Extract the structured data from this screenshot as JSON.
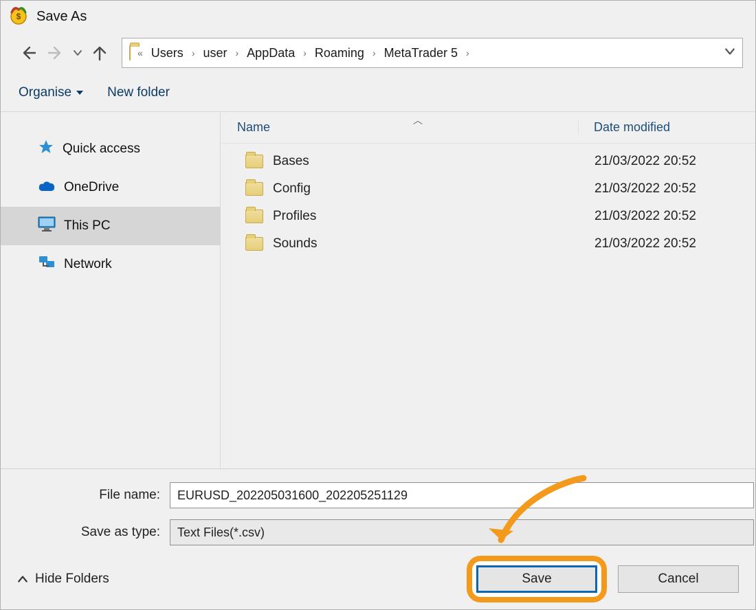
{
  "title": "Save As",
  "breadcrumbs": {
    "truncated": "«",
    "items": [
      "Users",
      "user",
      "AppData",
      "Roaming",
      "MetaTrader 5"
    ]
  },
  "toolbar": {
    "organise": "Organise",
    "new_folder": "New folder"
  },
  "nav_pane": {
    "quick_access": "Quick access",
    "onedrive": "OneDrive",
    "this_pc": "This PC",
    "network": "Network"
  },
  "columns": {
    "name": "Name",
    "date": "Date modified"
  },
  "files": [
    {
      "name": "Bases",
      "date": "21/03/2022 20:52"
    },
    {
      "name": "Config",
      "date": "21/03/2022 20:52"
    },
    {
      "name": "Profiles",
      "date": "21/03/2022 20:52"
    },
    {
      "name": "Sounds",
      "date": "21/03/2022 20:52"
    }
  ],
  "fields": {
    "file_name_label": "File name:",
    "file_name_value": "EURUSD_202205031600_202205251129",
    "save_type_label": "Save as type:",
    "save_type_value": "Text Files(*.csv)"
  },
  "buttons": {
    "hide_folders": "Hide Folders",
    "save": "Save",
    "cancel": "Cancel"
  }
}
